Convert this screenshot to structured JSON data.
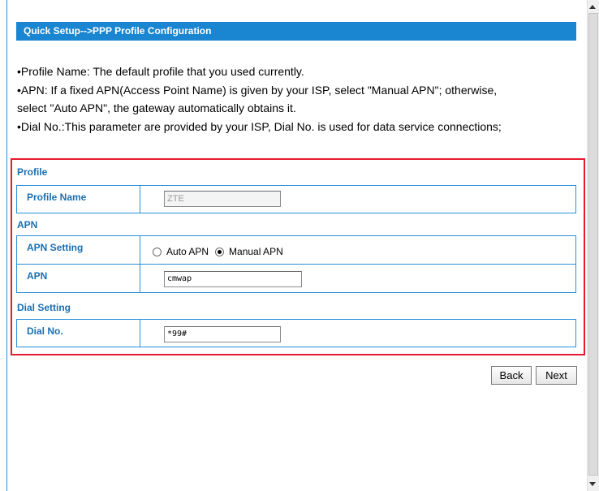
{
  "title": "Quick Setup-->PPP Profile Configuration",
  "help": {
    "line1": "•Profile Name: The default profile that you used currently.",
    "line2": "•APN: If a fixed APN(Access Point Name) is given by your ISP, select \"Manual APN\"; otherwise,",
    "line3": "select \"Auto APN\", the gateway automatically obtains it.",
    "line4": "•Dial No.:This parameter are provided by your ISP, Dial No. is used for data service connections;"
  },
  "profile": {
    "section_label": "Profile",
    "name_label": "Profile Name",
    "name_value": "ZTE"
  },
  "apn": {
    "section_label": "APN",
    "setting_label": "APN Setting",
    "options": [
      "Auto APN",
      "Manual APN"
    ],
    "selected": "Manual APN",
    "apn_label": "APN",
    "apn_value": "cmwap"
  },
  "dial": {
    "section_label": "Dial Setting",
    "label": "Dial No.",
    "value": "*99#"
  },
  "buttons": {
    "back": "Back",
    "next": "Next"
  },
  "colors": {
    "title_bg": "#1a85d0",
    "accent": "#1a6fb0",
    "highlight_border": "#e8192c"
  }
}
